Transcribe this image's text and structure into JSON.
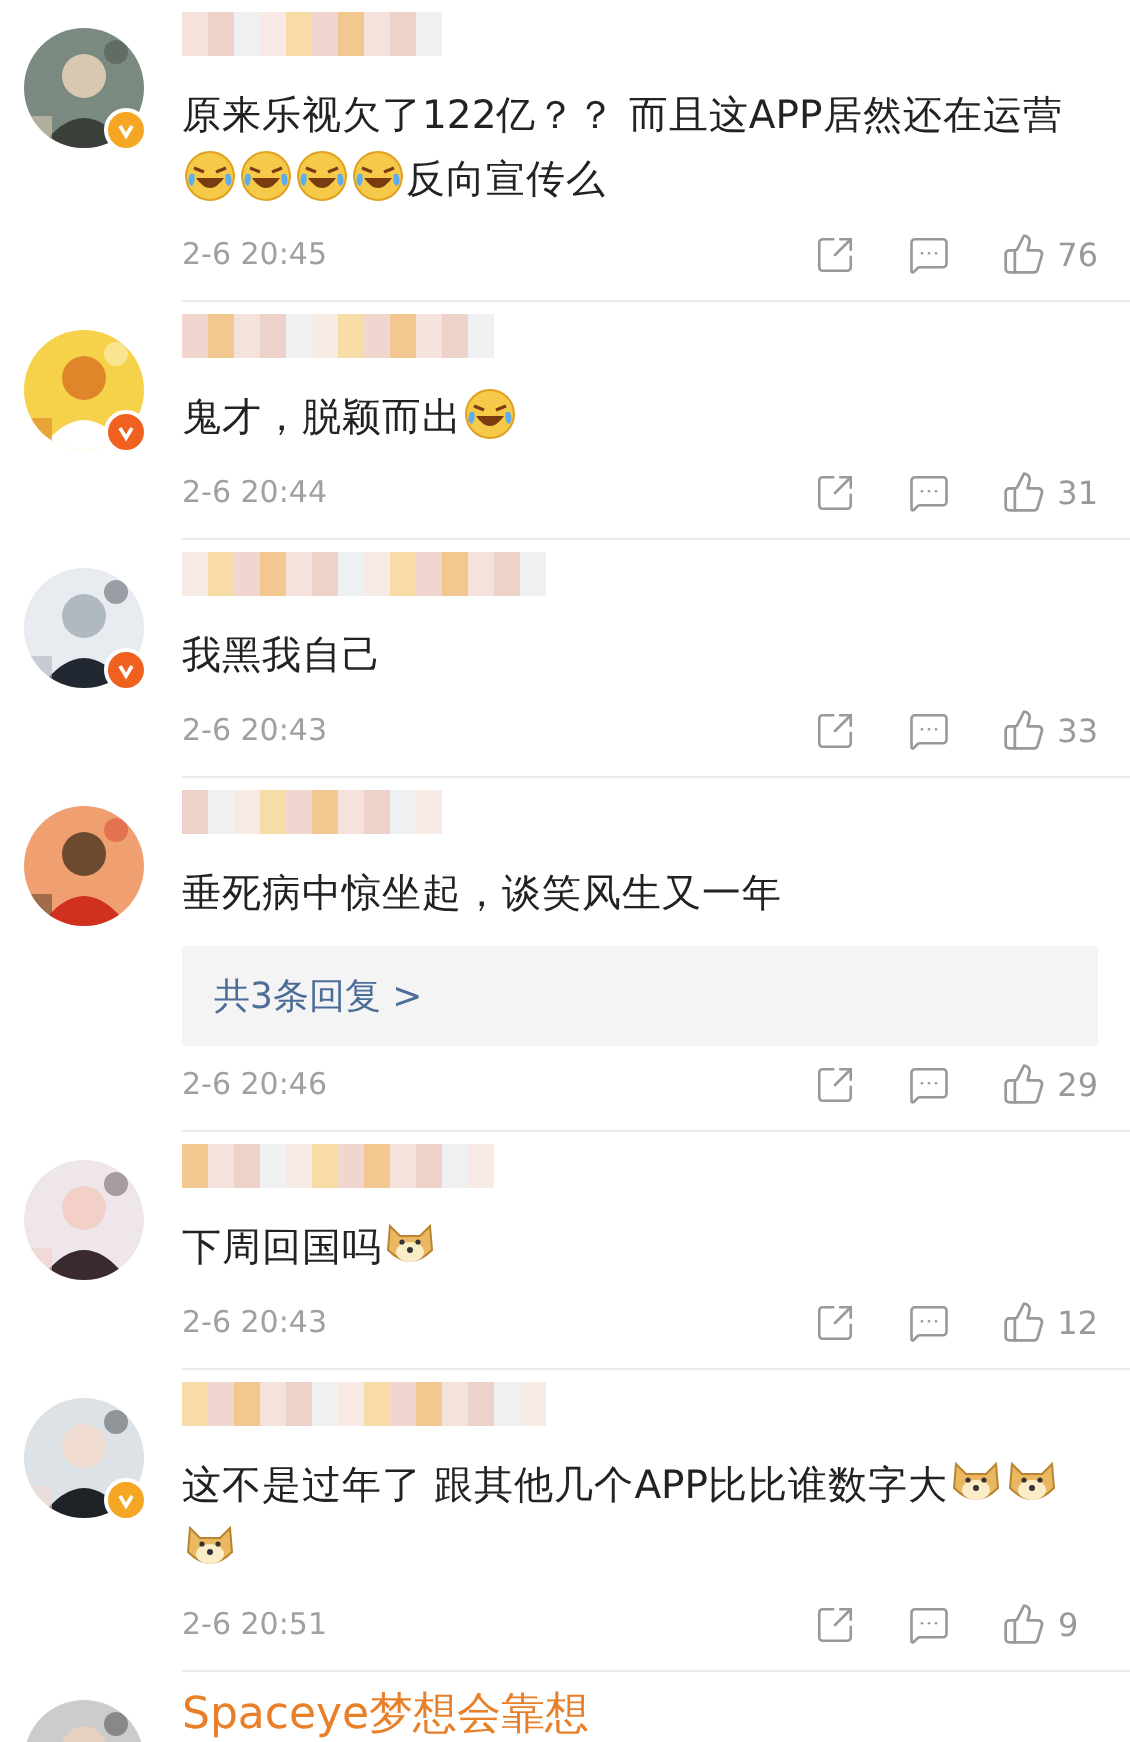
{
  "comments": [
    {
      "verified": true,
      "color": "#f5a623",
      "content": [
        {
          "kind": "text",
          "text": "原来乐视欠了122亿？？ 而且这APP居然还在运营"
        },
        {
          "kind": "laugh"
        },
        {
          "kind": "laugh"
        },
        {
          "kind": "laugh"
        },
        {
          "kind": "laugh"
        },
        {
          "kind": "text",
          "text": "反向宣传么"
        }
      ],
      "time": "2-6 20:45",
      "likes": "76"
    },
    {
      "verified": true,
      "color": "#f0601e",
      "content": [
        {
          "kind": "text",
          "text": "鬼才，脱颖而出"
        },
        {
          "kind": "laugh"
        }
      ],
      "time": "2-6 20:44",
      "likes": "31"
    },
    {
      "verified": true,
      "color": "#f0601e",
      "content": [
        {
          "kind": "text",
          "text": "我黑我自己"
        }
      ],
      "time": "2-6 20:43",
      "likes": "33"
    },
    {
      "verified": false,
      "content": [
        {
          "kind": "text",
          "text": "垂死病中惊坐起，谈笑风生又一年"
        }
      ],
      "replies": "共3条回复 >",
      "time": "2-6 20:46",
      "likes": "29"
    },
    {
      "verified": false,
      "content": [
        {
          "kind": "text",
          "text": "下周回国吗"
        },
        {
          "kind": "doge"
        }
      ],
      "time": "2-6 20:43",
      "likes": "12"
    },
    {
      "verified": true,
      "color": "#f5a623",
      "content": [
        {
          "kind": "text",
          "text": "这不是过年了 跟其他几个APP比比谁数字大"
        },
        {
          "kind": "doge"
        },
        {
          "kind": "doge"
        },
        {
          "kind": "doge"
        }
      ],
      "time": "2-6 20:51",
      "likes": "9"
    }
  ],
  "next_comment": {
    "username": "Spaceye梦想会靠想"
  }
}
